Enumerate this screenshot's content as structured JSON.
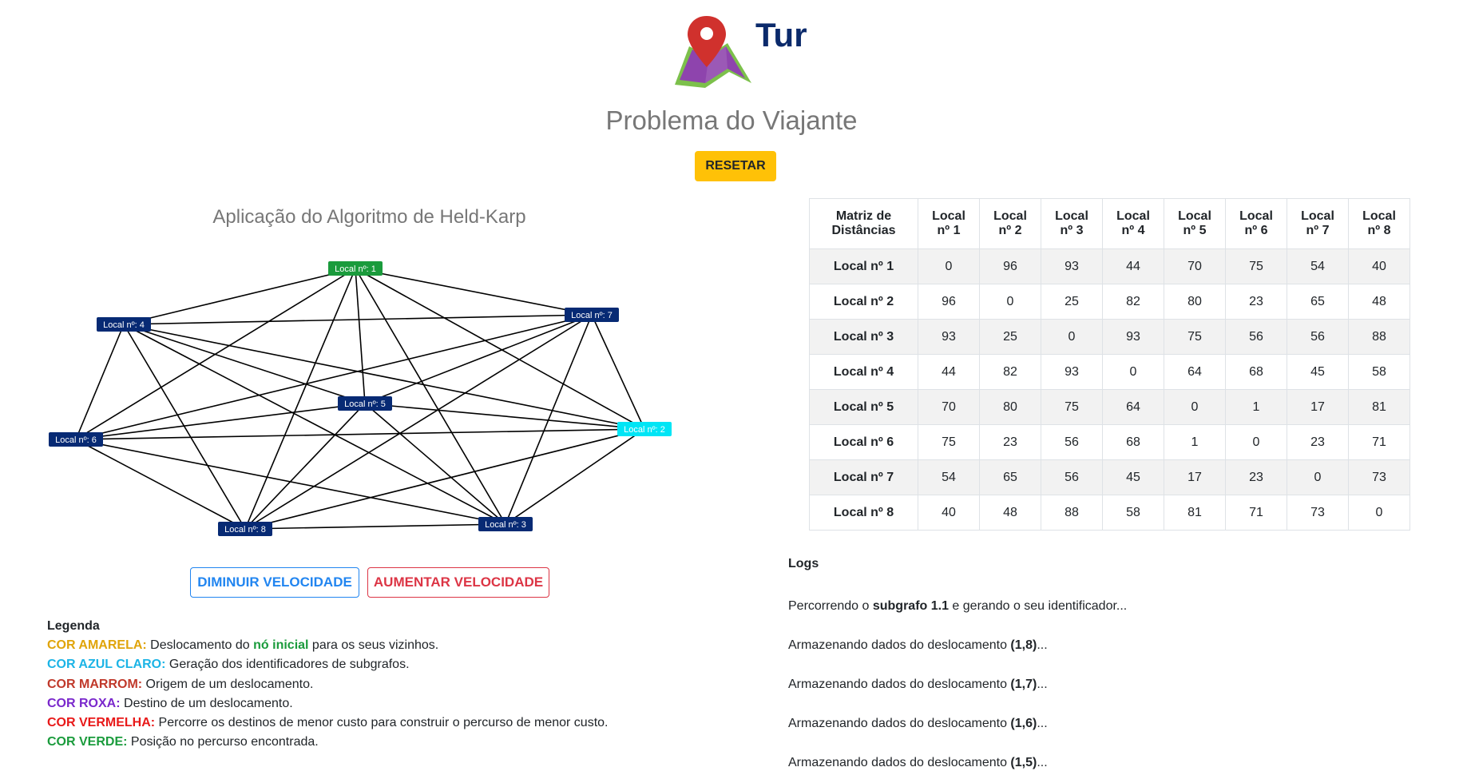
{
  "header": {
    "brand": "Tur",
    "subtitle": "Problema do Viajante",
    "reset_label": "RESETAR"
  },
  "logo": {
    "icon": "map-pin-icon",
    "colors": {
      "pin": "#d0312d",
      "map": "#8e44ad",
      "map_border": "#7cc04b"
    }
  },
  "graph": {
    "title": "Aplicação do Algoritmo de Held-Karp",
    "nodes": [
      {
        "id": 1,
        "label": "Local nº: 1",
        "state": "start"
      },
      {
        "id": 2,
        "label": "Local nº: 2",
        "state": "subgraph"
      },
      {
        "id": 3,
        "label": "Local nº: 3",
        "state": "normal"
      },
      {
        "id": 4,
        "label": "Local nº: 4",
        "state": "normal"
      },
      {
        "id": 5,
        "label": "Local nº: 5",
        "state": "normal"
      },
      {
        "id": 6,
        "label": "Local nº: 6",
        "state": "normal"
      },
      {
        "id": 7,
        "label": "Local nº: 7",
        "state": "normal"
      },
      {
        "id": 8,
        "label": "Local nº: 8",
        "state": "normal"
      }
    ],
    "colors": {
      "node": "#072a74",
      "start": "#1a9b3c",
      "subgraph": "#00e5f5",
      "edge": "#000000"
    }
  },
  "controls": {
    "slower_label": "DIMINUIR VELOCIDADE",
    "faster_label": "AUMENTAR VELOCIDADE"
  },
  "legend": {
    "title": "Legenda",
    "items": [
      {
        "key": "COR AMARELA:",
        "color": "#e0a40a",
        "pre": " Deslocamento do ",
        "highlight": "nó inicial",
        "highlight_color": "#1a9b3c",
        "post": " para os seus vizinhos."
      },
      {
        "key": "COR AZUL CLARO:",
        "color": "#1cb4e6",
        "text": " Geração dos identificadores de subgrafos."
      },
      {
        "key": "COR MARROM:",
        "color": "#c0392b",
        "text": " Origem de um deslocamento."
      },
      {
        "key": "COR ROXA:",
        "color": "#7a28cc",
        "text": " Destino de um deslocamento."
      },
      {
        "key": "COR VERMELHA:",
        "color": "#e81919",
        "text": " Percorre os destinos de menor custo para construir o percurso de menor custo."
      },
      {
        "key": "COR VERDE:",
        "color": "#1a9b3c",
        "text": " Posição no percurso encontrada."
      }
    ]
  },
  "matrix": {
    "corner": [
      "Matriz de",
      "Distâncias"
    ],
    "headers": [
      [
        "Local",
        "nº 1"
      ],
      [
        "Local",
        "nº 2"
      ],
      [
        "Local",
        "nº 3"
      ],
      [
        "Local",
        "nº 4"
      ],
      [
        "Local",
        "nº 5"
      ],
      [
        "Local",
        "nº 6"
      ],
      [
        "Local",
        "nº 7"
      ],
      [
        "Local",
        "nº 8"
      ]
    ],
    "rows": [
      {
        "label": "Local nº 1",
        "values": [
          "0",
          "96",
          "93",
          "44",
          "70",
          "75",
          "54",
          "40"
        ]
      },
      {
        "label": "Local nº 2",
        "values": [
          "96",
          "0",
          "25",
          "82",
          "80",
          "23",
          "65",
          "48"
        ]
      },
      {
        "label": "Local nº 3",
        "values": [
          "93",
          "25",
          "0",
          "93",
          "75",
          "56",
          "56",
          "88"
        ]
      },
      {
        "label": "Local nº 4",
        "values": [
          "44",
          "82",
          "93",
          "0",
          "64",
          "68",
          "45",
          "58"
        ]
      },
      {
        "label": "Local nº 5",
        "values": [
          "70",
          "80",
          "75",
          "64",
          "0",
          "1",
          "17",
          "81"
        ]
      },
      {
        "label": "Local nº 6",
        "values": [
          "75",
          "23",
          "56",
          "68",
          "1",
          "0",
          "23",
          "71"
        ]
      },
      {
        "label": "Local nº 7",
        "values": [
          "54",
          "65",
          "56",
          "45",
          "17",
          "23",
          "0",
          "73"
        ]
      },
      {
        "label": "Local nº 8",
        "values": [
          "40",
          "48",
          "88",
          "58",
          "81",
          "71",
          "73",
          "0"
        ]
      }
    ]
  },
  "logs": {
    "title": "Logs",
    "entries": [
      {
        "pre": "Percorrendo o ",
        "bold": "subgrafo 1.1",
        "post": " e gerando o seu identificador..."
      },
      {
        "pre": "Armazenando dados do deslocamento ",
        "bold": "(1,8)",
        "post": "..."
      },
      {
        "pre": "Armazenando dados do deslocamento ",
        "bold": "(1,7)",
        "post": "..."
      },
      {
        "pre": "Armazenando dados do deslocamento ",
        "bold": "(1,6)",
        "post": "..."
      },
      {
        "pre": "Armazenando dados do deslocamento ",
        "bold": "(1,5)",
        "post": "..."
      }
    ]
  }
}
